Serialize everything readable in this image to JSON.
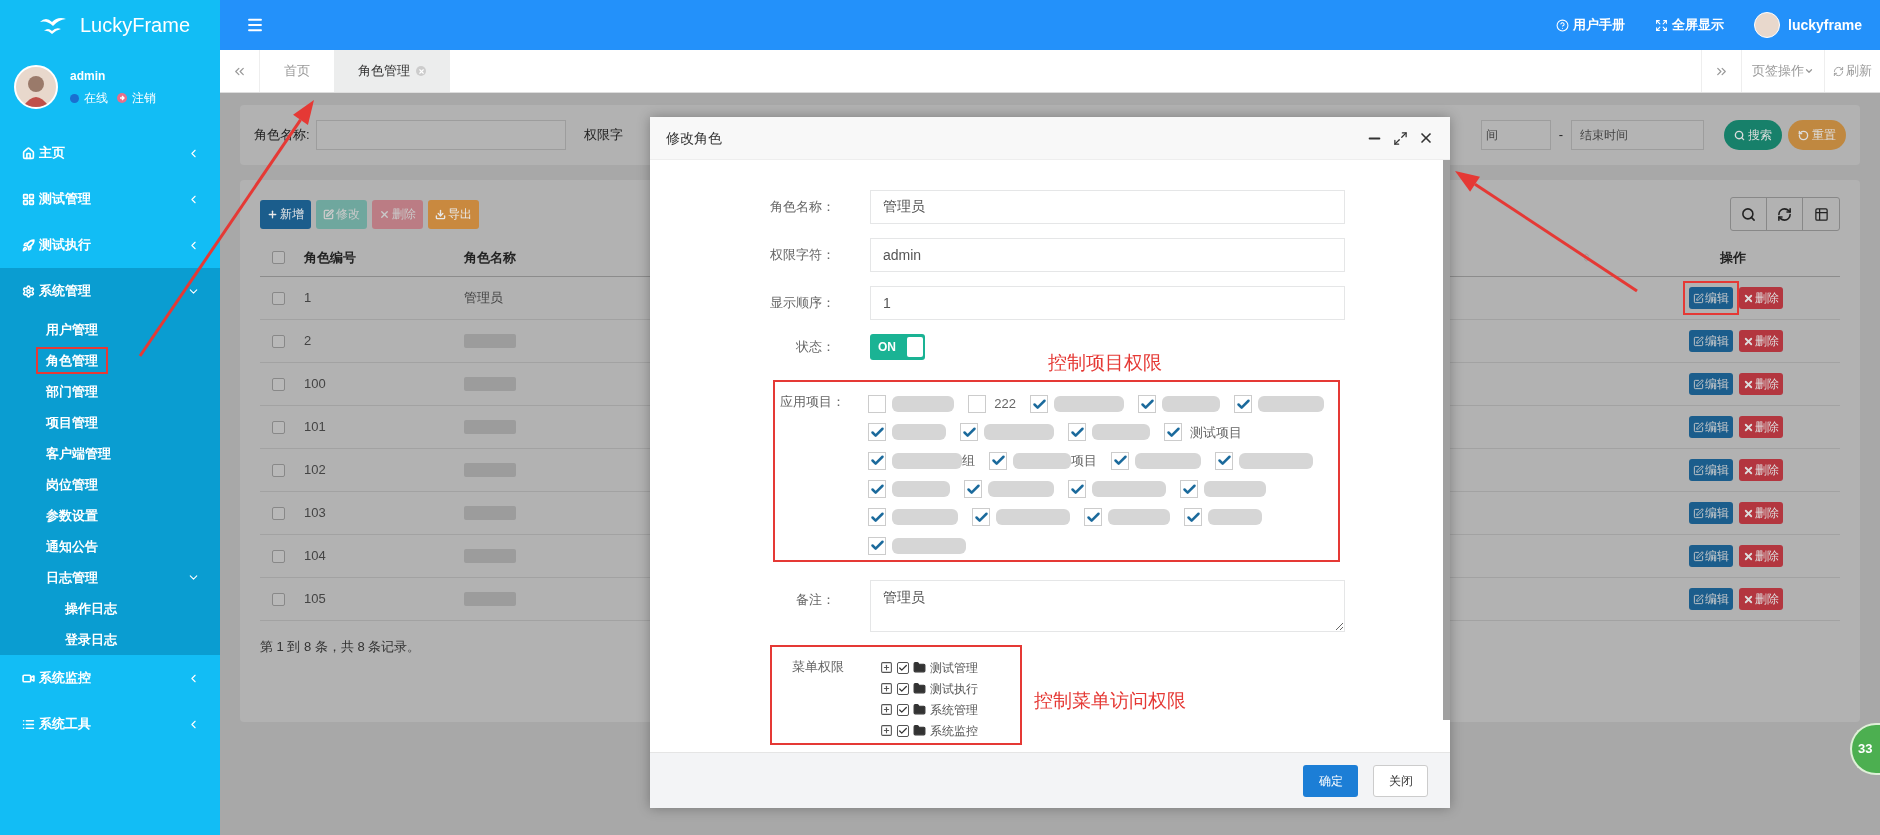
{
  "brand": {
    "name": "LuckyFrame"
  },
  "user_panel": {
    "name": "admin",
    "status": "在线",
    "logout": "注销"
  },
  "sidebar": {
    "items": [
      {
        "label": "主页",
        "expanded": false
      },
      {
        "label": "测试管理",
        "expanded": false
      },
      {
        "label": "测试执行",
        "expanded": false
      },
      {
        "label": "系统管理",
        "expanded": true,
        "children": [
          {
            "label": "用户管理",
            "annotated": false
          },
          {
            "label": "角色管理",
            "annotated": true
          },
          {
            "label": "部门管理",
            "annotated": false
          },
          {
            "label": "项目管理",
            "annotated": false
          },
          {
            "label": "客户端管理",
            "annotated": false
          },
          {
            "label": "岗位管理",
            "annotated": false
          },
          {
            "label": "参数设置",
            "annotated": false
          },
          {
            "label": "通知公告",
            "annotated": false
          },
          {
            "label": "日志管理",
            "annotated": false,
            "expanded": true,
            "children": [
              {
                "label": "操作日志",
                "annotated": false
              },
              {
                "label": "登录日志",
                "annotated": false
              }
            ]
          }
        ]
      },
      {
        "label": "系统监控",
        "expanded": false
      },
      {
        "label": "系统工具",
        "expanded": false
      }
    ]
  },
  "topbar": {
    "links": [
      "用户手册",
      "全屏显示"
    ],
    "user": "luckyframe"
  },
  "tabs": [
    {
      "label": "首页",
      "selected": false
    },
    {
      "label": "角色管理",
      "selected": true
    }
  ],
  "tab_actions": {
    "menu": "页签操作",
    "refresh": "刷新"
  },
  "search": {
    "left_fields": [
      {
        "label": "角色名称:"
      }
    ],
    "covered_label": "权限字",
    "start_field_value": "间",
    "separator": "-",
    "end_field_placeholder": "结束时间",
    "buttons": [
      "搜索",
      "重置"
    ]
  },
  "toolbar": [
    {
      "label": "新增",
      "disabled": false
    },
    {
      "label": "修改",
      "disabled": true
    },
    {
      "label": "删除",
      "disabled": true
    },
    {
      "label": "导出",
      "disabled": false
    }
  ],
  "table": {
    "select_all_checked": false,
    "columns": [
      "角色编号",
      "角色名称",
      "操作"
    ],
    "rows": [
      {
        "checked": false,
        "id": "1",
        "kind": "text",
        "name": "管理员",
        "actions": [
          "编辑",
          "删除"
        ],
        "annotated": true
      },
      {
        "checked": false,
        "id": "2",
        "kind": "blurred",
        "actions": [
          "编辑",
          "删除"
        ],
        "annotated": false
      },
      {
        "checked": false,
        "id": "100",
        "kind": "blurred",
        "actions": [
          "编辑",
          "删除"
        ],
        "annotated": false
      },
      {
        "checked": false,
        "id": "101",
        "kind": "blurred",
        "actions": [
          "编辑",
          "删除"
        ],
        "annotated": false
      },
      {
        "checked": false,
        "id": "102",
        "kind": "blurred",
        "actions": [
          "编辑",
          "删除"
        ],
        "annotated": false
      },
      {
        "checked": false,
        "id": "103",
        "kind": "blurred",
        "actions": [
          "编辑",
          "删除"
        ],
        "annotated": false
      },
      {
        "checked": false,
        "id": "104",
        "kind": "blurred",
        "actions": [
          "编辑",
          "删除"
        ],
        "annotated": false
      },
      {
        "checked": false,
        "id": "105",
        "kind": "blurred",
        "actions": [
          "编辑",
          "删除"
        ],
        "annotated": false
      }
    ],
    "pagination": "第 1 到 8 条，共 8 条记录。"
  },
  "modal": {
    "title": "修改角色",
    "fields": [
      {
        "label": "角色名称：",
        "value": "管理员"
      },
      {
        "label": "权限字符：",
        "value": "admin"
      },
      {
        "label": "显示顺序：",
        "value": "1"
      }
    ],
    "status": {
      "label": "状态：",
      "on": true,
      "text": "ON"
    },
    "projects": {
      "label": "应用项目：",
      "annotated": true,
      "rows": [
        [
          {
            "kind": "blurred",
            "checked": false
          },
          {
            "kind": "text",
            "checked": false,
            "label": "222"
          },
          {
            "kind": "blurred",
            "checked": true
          },
          {
            "kind": "blurred",
            "checked": true
          },
          {
            "kind": "blurred",
            "checked": true
          }
        ],
        [
          {
            "kind": "blurred",
            "checked": true
          },
          {
            "kind": "blurred",
            "checked": true
          },
          {
            "kind": "blurred",
            "checked": true
          },
          {
            "kind": "text",
            "checked": true,
            "label": "测试项目"
          }
        ],
        [
          {
            "kind": "blurred",
            "checked": true,
            "suffix": "组"
          },
          {
            "kind": "blurred",
            "checked": true,
            "suffix": "项目"
          },
          {
            "kind": "blurred",
            "checked": true
          },
          {
            "kind": "blurred",
            "checked": true
          }
        ],
        [
          {
            "kind": "blurred",
            "checked": true
          },
          {
            "kind": "blurred",
            "checked": true
          },
          {
            "kind": "blurred",
            "checked": true
          },
          {
            "kind": "blurred",
            "checked": true
          }
        ],
        [
          {
            "kind": "blurred",
            "checked": true
          },
          {
            "kind": "blurred",
            "checked": true
          },
          {
            "kind": "blurred",
            "checked": true
          },
          {
            "kind": "blurred",
            "checked": true
          }
        ],
        [
          {
            "kind": "blurred",
            "checked": true
          }
        ]
      ]
    },
    "note": {
      "label": "备注：",
      "value": "管理员"
    },
    "menu_tree": {
      "label": "菜单权限",
      "annotated": true,
      "items": [
        {
          "label": "测试管理",
          "checked": true,
          "expanded": false
        },
        {
          "label": "测试执行",
          "checked": true,
          "expanded": false
        },
        {
          "label": "系统管理",
          "checked": true,
          "expanded": false
        },
        {
          "label": "系统监控",
          "checked": true,
          "expanded": false
        }
      ]
    },
    "buttons": [
      "确定",
      "关闭"
    ]
  },
  "annotations": [
    "控制项目权限",
    "控制菜单访问权限"
  ],
  "badge": "33"
}
